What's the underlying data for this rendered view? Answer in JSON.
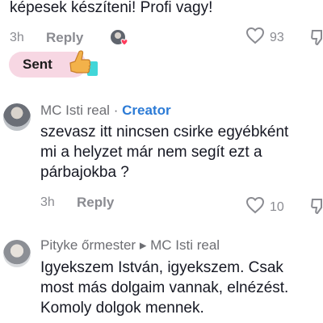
{
  "top_comment": {
    "text_tail": "képesek készíteni! Profi vagy!",
    "time": "3h",
    "reply_label": "Reply",
    "likes": "93",
    "sent_label": "Sent"
  },
  "comment1": {
    "author": "MC Isti real",
    "separator": "·",
    "badge": "Creator",
    "text_lines": [
      "szevasz itt nincsen csirke egyébként",
      "mi a helyzet már nem segít ezt a",
      "párbajokba ?"
    ],
    "time": "3h",
    "reply_label": "Reply",
    "likes": "10"
  },
  "comment2": {
    "author": "Pityke őrmester",
    "reply_to_arrow": "▸",
    "reply_to": "MC Isti real",
    "text_lines": [
      "Igyekszem István, igyekszem. Csak",
      "most más dolgaim vannak, elnézést.",
      "Komoly dolgok mennek."
    ]
  },
  "icons": {
    "like": "heart-outline-icon",
    "dislike": "thumbs-down-outline-icon",
    "liked_by_creator": "creator-liked-avatar-icon",
    "sent_emoji": "thumbs-up-emoji-icon"
  },
  "colors": {
    "creator": "#2c7bd6",
    "sent_pill": "#f7d7e3",
    "muted": "#8a8b91",
    "heart": "#ff3b5c"
  }
}
